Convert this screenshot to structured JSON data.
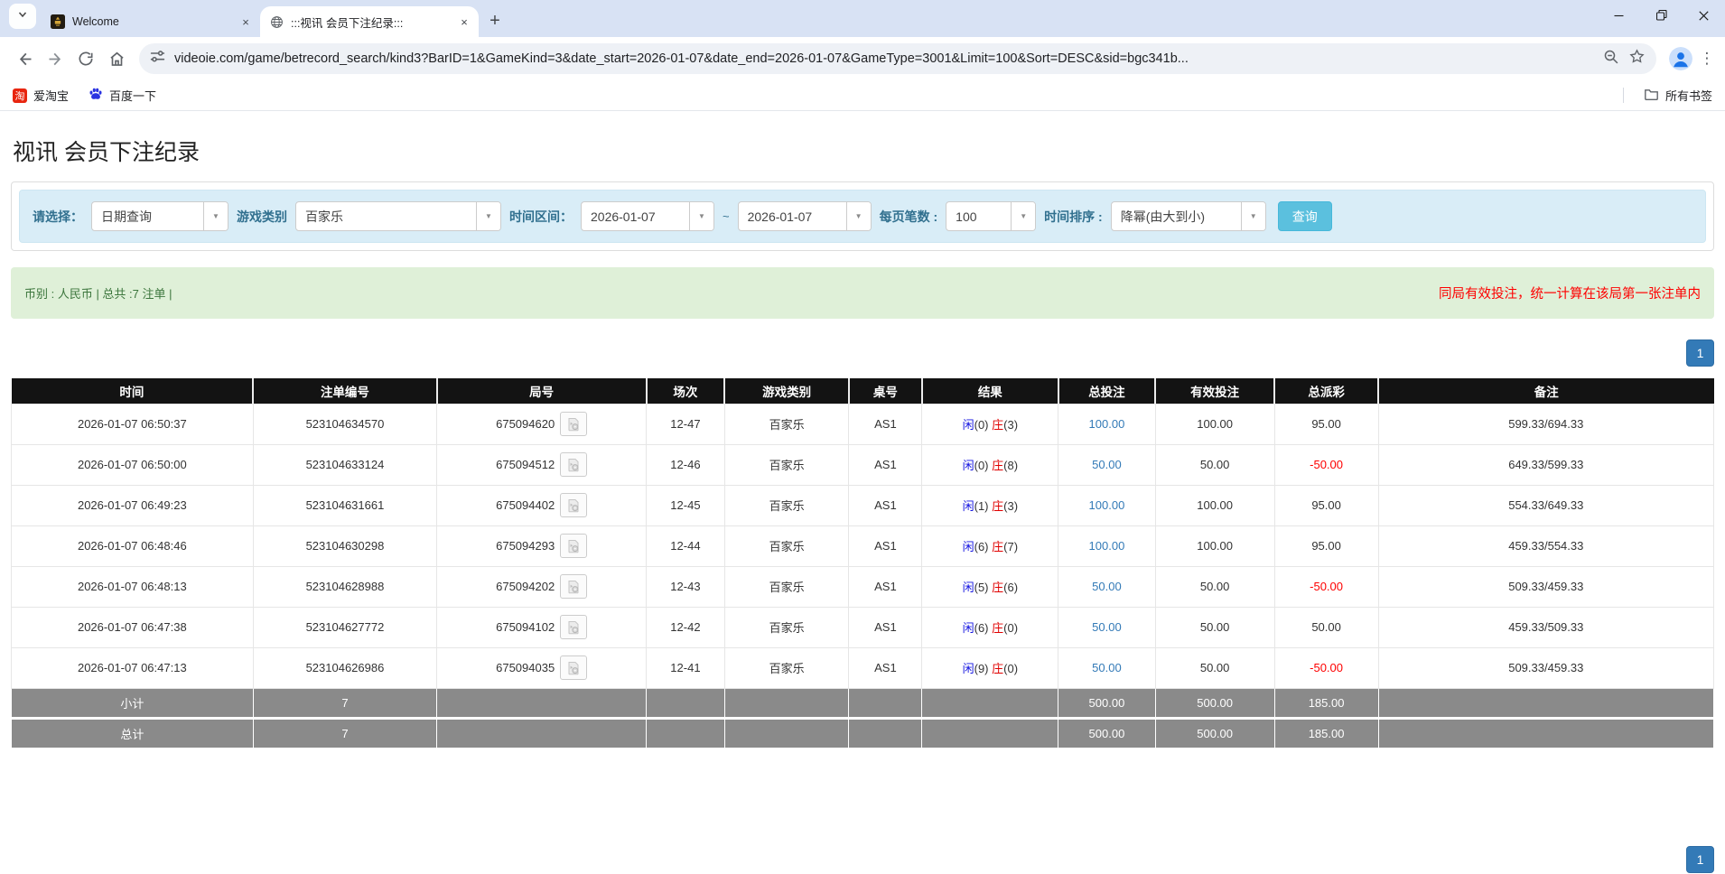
{
  "browser": {
    "tabs": [
      {
        "title": "Welcome"
      },
      {
        "title": ":::视讯 会员下注纪录:::"
      }
    ],
    "url": "videoie.com/game/betrecord_search/kind3?BarID=1&GameKind=3&date_start=2026-01-07&date_end=2026-01-07&GameType=3001&Limit=100&Sort=DESC&sid=bgc341b...",
    "bookmarks": [
      "爱淘宝",
      "百度一下"
    ],
    "all_bookmarks_label": "所有书签"
  },
  "page": {
    "title": "视讯 会员下注纪录",
    "filters": {
      "select_label": "请选择：",
      "select_value": "日期查询",
      "game_kind_label": "游戏类别",
      "game_kind_value": "百家乐",
      "range_label": "时间区间：",
      "date_start": "2026-01-07",
      "tilde": "~",
      "date_end": "2026-01-07",
      "per_page_label": "每页笔数 :",
      "per_page_value": "100",
      "sort_label": "时间排序 :",
      "sort_value": "降幂(由大到小)",
      "search_button": "查询"
    },
    "summary": {
      "left": "币别 : 人民币 | 总共 :7 注单 |",
      "notice": "同局有效投注，统一计算在该局第一张注单内"
    },
    "pagination": "1",
    "colors": {
      "pagination_blue": "#337ab7",
      "search_button_blue": "#5bc0de",
      "player_blue": "#1414e0",
      "banker_red": "#e00000",
      "negative_red": "#fe0000"
    },
    "table": {
      "headers": [
        "时间",
        "注单编号",
        "局号",
        "场次",
        "游戏类别",
        "桌号",
        "结果",
        "总投注",
        "有效投注",
        "总派彩",
        "备注"
      ],
      "rows": [
        {
          "time": "2026-01-07 06:50:37",
          "bet_id": "523104634570",
          "round_id": "675094620",
          "session": "12-47",
          "game": "百家乐",
          "table_no": "AS1",
          "rx": "闲",
          "rxn": "(0)",
          "rz": "庄",
          "rzn": "(3)",
          "bet": "100.00",
          "valid": "100.00",
          "payout": "95.00",
          "payout_state": "pos",
          "note": "599.33/694.33"
        },
        {
          "time": "2026-01-07 06:50:00",
          "bet_id": "523104633124",
          "round_id": "675094512",
          "session": "12-46",
          "game": "百家乐",
          "table_no": "AS1",
          "rx": "闲",
          "rxn": "(0)",
          "rz": "庄",
          "rzn": "(8)",
          "bet": "50.00",
          "valid": "50.00",
          "payout": "-50.00",
          "payout_state": "neg",
          "note": "649.33/599.33"
        },
        {
          "time": "2026-01-07 06:49:23",
          "bet_id": "523104631661",
          "round_id": "675094402",
          "session": "12-45",
          "game": "百家乐",
          "table_no": "AS1",
          "rx": "闲",
          "rxn": "(1)",
          "rz": "庄",
          "rzn": "(3)",
          "bet": "100.00",
          "valid": "100.00",
          "payout": "95.00",
          "payout_state": "pos",
          "note": "554.33/649.33"
        },
        {
          "time": "2026-01-07 06:48:46",
          "bet_id": "523104630298",
          "round_id": "675094293",
          "session": "12-44",
          "game": "百家乐",
          "table_no": "AS1",
          "rx": "闲",
          "rxn": "(6)",
          "rz": "庄",
          "rzn": "(7)",
          "bet": "100.00",
          "valid": "100.00",
          "payout": "95.00",
          "payout_state": "pos",
          "note": "459.33/554.33"
        },
        {
          "time": "2026-01-07 06:48:13",
          "bet_id": "523104628988",
          "round_id": "675094202",
          "session": "12-43",
          "game": "百家乐",
          "table_no": "AS1",
          "rx": "闲",
          "rxn": "(5)",
          "rz": "庄",
          "rzn": "(6)",
          "bet": "50.00",
          "valid": "50.00",
          "payout": "-50.00",
          "payout_state": "neg",
          "note": "509.33/459.33"
        },
        {
          "time": "2026-01-07 06:47:38",
          "bet_id": "523104627772",
          "round_id": "675094102",
          "session": "12-42",
          "game": "百家乐",
          "table_no": "AS1",
          "rx": "闲",
          "rxn": "(6)",
          "rz": "庄",
          "rzn": "(0)",
          "bet": "50.00",
          "valid": "50.00",
          "payout": "50.00",
          "payout_state": "pos",
          "note": "459.33/509.33"
        },
        {
          "time": "2026-01-07 06:47:13",
          "bet_id": "523104626986",
          "round_id": "675094035",
          "session": "12-41",
          "game": "百家乐",
          "table_no": "AS1",
          "rx": "闲",
          "rxn": "(9)",
          "rz": "庄",
          "rzn": "(0)",
          "bet": "50.00",
          "valid": "50.00",
          "payout": "-50.00",
          "payout_state": "neg",
          "note": "509.33/459.33"
        }
      ],
      "subtotal": {
        "label": "小计",
        "count": "7",
        "bet": "500.00",
        "valid": "500.00",
        "payout": "185.00"
      },
      "total": {
        "label": "总计",
        "count": "7",
        "bet": "500.00",
        "valid": "500.00",
        "payout": "185.00"
      }
    }
  }
}
